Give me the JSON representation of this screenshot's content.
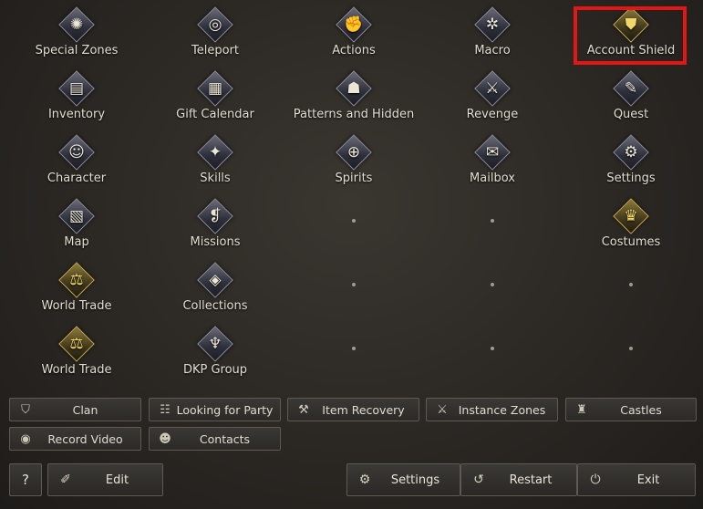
{
  "menu": {
    "items": [
      {
        "label": "Special Zones",
        "icon": "gear-globe-icon",
        "glyph": "✺"
      },
      {
        "label": "Teleport",
        "icon": "swirl-icon",
        "glyph": "◎"
      },
      {
        "label": "Actions",
        "icon": "fist-icon",
        "glyph": "✊"
      },
      {
        "label": "Macro",
        "icon": "compass-icon",
        "glyph": "✲"
      },
      {
        "label": "Account Shield",
        "icon": "shield-icon",
        "glyph": "⛊"
      },
      {
        "label": "Inventory",
        "icon": "chest-icon",
        "glyph": "▤"
      },
      {
        "label": "Gift Calendar",
        "icon": "calendar-icon",
        "glyph": "▦"
      },
      {
        "label": "Patterns and Hidden",
        "icon": "hidden-icon",
        "glyph": "☗"
      },
      {
        "label": "Revenge",
        "icon": "dagger-icon",
        "glyph": "⚔"
      },
      {
        "label": "Quest",
        "icon": "scroll-quill-icon",
        "glyph": "✎"
      },
      {
        "label": "Character",
        "icon": "helmet-icon",
        "glyph": "☺"
      },
      {
        "label": "Skills",
        "icon": "skill-book-icon",
        "glyph": "✦"
      },
      {
        "label": "Spirits",
        "icon": "spirit-rune-icon",
        "glyph": "⊕"
      },
      {
        "label": "Mailbox",
        "icon": "envelope-icon",
        "glyph": "✉"
      },
      {
        "label": "Settings",
        "icon": "settings-icon",
        "glyph": "⚙"
      },
      {
        "label": "Map",
        "icon": "map-icon",
        "glyph": "▧"
      },
      {
        "label": "Missions",
        "icon": "mission-scroll-icon",
        "glyph": "❡"
      },
      {
        "label": "",
        "icon": "empty-slot",
        "glyph": ""
      },
      {
        "label": "",
        "icon": "empty-slot",
        "glyph": ""
      },
      {
        "label": "Costumes",
        "icon": "dress-icon",
        "glyph": "♛"
      },
      {
        "label": "World Trade",
        "icon": "scales-icon",
        "glyph": "⚖"
      },
      {
        "label": "Collections",
        "icon": "collection-gem-icon",
        "glyph": "◈"
      },
      {
        "label": "",
        "icon": "empty-slot",
        "glyph": ""
      },
      {
        "label": "",
        "icon": "empty-slot",
        "glyph": ""
      },
      {
        "label": "",
        "icon": "empty-slot",
        "glyph": ""
      },
      {
        "label": "World Trade",
        "icon": "scales-icon",
        "glyph": "⚖"
      },
      {
        "label": "DKP Group",
        "icon": "dkp-crest-icon",
        "glyph": "♆"
      },
      {
        "label": "",
        "icon": "empty-slot",
        "glyph": ""
      },
      {
        "label": "",
        "icon": "empty-slot",
        "glyph": ""
      },
      {
        "label": "",
        "icon": "empty-slot",
        "glyph": ""
      }
    ]
  },
  "quick_buttons": [
    {
      "label": "Clan",
      "icon": "clan-shield-icon",
      "glyph": "⛉"
    },
    {
      "label": "Looking for Party",
      "icon": "party-icon",
      "glyph": "☷"
    },
    {
      "label": "Item Recovery",
      "icon": "anvil-icon",
      "glyph": "⚒"
    },
    {
      "label": "Instance Zones",
      "icon": "crossed-swords-icon",
      "glyph": "⚔"
    },
    {
      "label": "Castles",
      "icon": "castle-icon",
      "glyph": "♜"
    },
    {
      "label": "Record Video",
      "icon": "film-reel-icon",
      "glyph": "◉"
    },
    {
      "label": "Contacts",
      "icon": "contacts-icon",
      "glyph": "☻"
    }
  ],
  "bottom_bar": {
    "help": {
      "label": "?",
      "icon": "help-icon"
    },
    "edit": {
      "label": "Edit",
      "icon": "edit-icon",
      "glyph": "✐"
    },
    "settings": {
      "label": "Settings",
      "icon": "gear-icon",
      "glyph": "⚙"
    },
    "restart": {
      "label": "Restart",
      "icon": "restart-icon",
      "glyph": "↺"
    },
    "exit": {
      "label": "Exit",
      "icon": "power-icon",
      "glyph": "⏻"
    }
  },
  "highlight_color": "#e31515"
}
